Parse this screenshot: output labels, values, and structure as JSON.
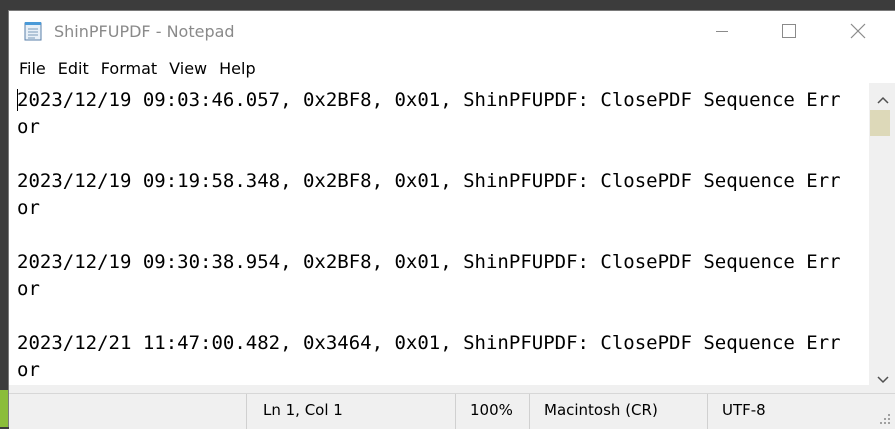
{
  "window": {
    "title": "ShinPFUPDF - Notepad",
    "icon": "notepad-icon"
  },
  "menu": {
    "items": [
      {
        "label": "File"
      },
      {
        "label": "Edit"
      },
      {
        "label": "Format"
      },
      {
        "label": "View"
      },
      {
        "label": "Help"
      }
    ]
  },
  "editor": {
    "content": "2023/12/19 09:03:46.057, 0x2BF8, 0x01, ShinPFUPDF: ClosePDF Sequence Error\n\n2023/12/19 09:19:58.348, 0x2BF8, 0x01, ShinPFUPDF: ClosePDF Sequence Error\n\n2023/12/19 09:30:38.954, 0x2BF8, 0x01, ShinPFUPDF: ClosePDF Sequence Error\n\n2023/12/21 11:47:00.482, 0x3464, 0x01, ShinPFUPDF: ClosePDF Sequence Error"
  },
  "status": {
    "position": "Ln 1, Col 1",
    "zoom": "100%",
    "line_ending": "Macintosh (CR)",
    "encoding": "UTF-8"
  },
  "colors": {
    "scroll_thumb": "#ddd9b9",
    "title_text": "#8a8a8a",
    "desktop": "#8bbd3a"
  }
}
